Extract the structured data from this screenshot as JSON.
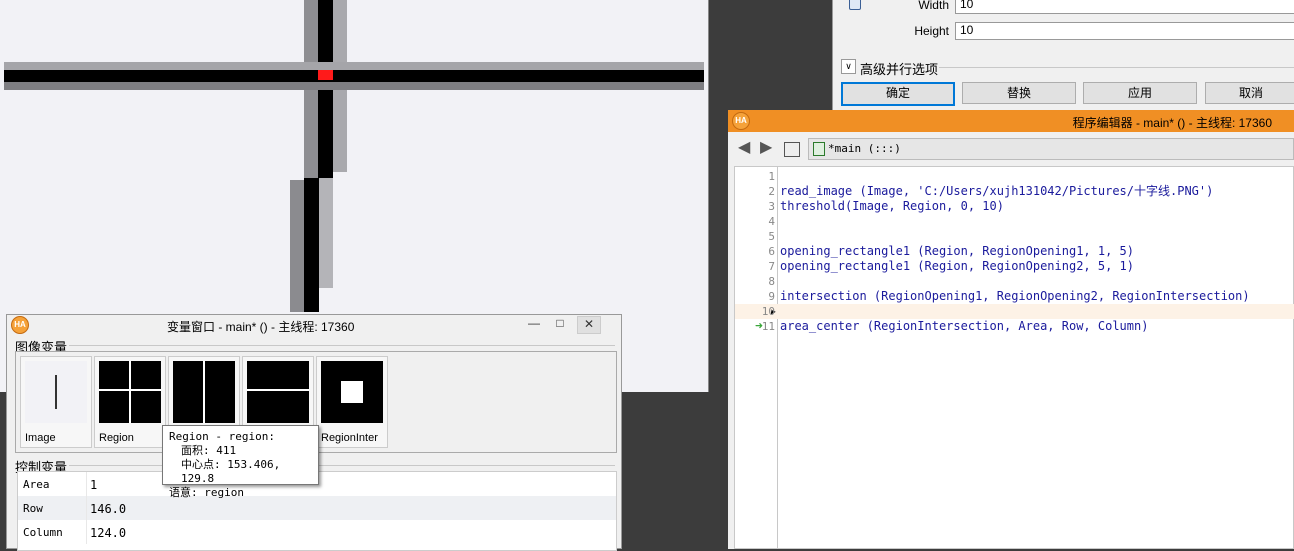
{
  "param_dialog": {
    "width_label": "Width",
    "width_value": "10",
    "height_label": "Height",
    "height_value": "10",
    "advanced_label": "高级并行选项",
    "buttons": {
      "ok": "确定",
      "replace": "替换",
      "apply": "应用",
      "cancel": "取消"
    }
  },
  "editor": {
    "title": "程序编辑器 - main* () - 主线程: 17360",
    "tab_label": "*main (:::)",
    "lines": [
      {
        "num": "1",
        "code": ""
      },
      {
        "num": "2",
        "code": "read_image (Image, 'C:/Users/xujh131042/Pictures/十字线.PNG')"
      },
      {
        "num": "3",
        "code": "threshold(Image, Region, 0, 10)"
      },
      {
        "num": "4",
        "code": ""
      },
      {
        "num": "5",
        "code": ""
      },
      {
        "num": "6",
        "code": "opening_rectangle1 (Region, RegionOpening1, 1, 5)"
      },
      {
        "num": "7",
        "code": "opening_rectangle1 (Region, RegionOpening2, 5, 1)"
      },
      {
        "num": "8",
        "code": ""
      },
      {
        "num": "9",
        "code": "intersection (RegionOpening1, RegionOpening2, RegionIntersection)"
      },
      {
        "num": "10",
        "code": ""
      },
      {
        "num": "11",
        "code": "area_center (RegionIntersection, Area, Row, Column)"
      }
    ]
  },
  "var_window": {
    "title": "变量窗口 - main* () - 主线程: 17360",
    "iconic_label": "图像变量",
    "control_label": "控制变量",
    "thumbnails": [
      "Image",
      "Region",
      "",
      "",
      "RegionInter"
    ],
    "control_vars": [
      {
        "name": "Area",
        "value": "1"
      },
      {
        "name": "Row",
        "value": "146.0"
      },
      {
        "name": "Column",
        "value": "124.0"
      }
    ]
  },
  "tooltip": {
    "line1": "Region - region:",
    "line2": "面积: 411",
    "line3": "中心点: 153.406, 129.8",
    "line4": "语意: region"
  },
  "icons": [
    "ha-logo",
    "back-arrow-icon",
    "forward-arrow-icon",
    "insert-icon",
    "procedure-icon",
    "pc-arrow-icon",
    "minimize-icon",
    "maximize-icon",
    "close-icon"
  ]
}
